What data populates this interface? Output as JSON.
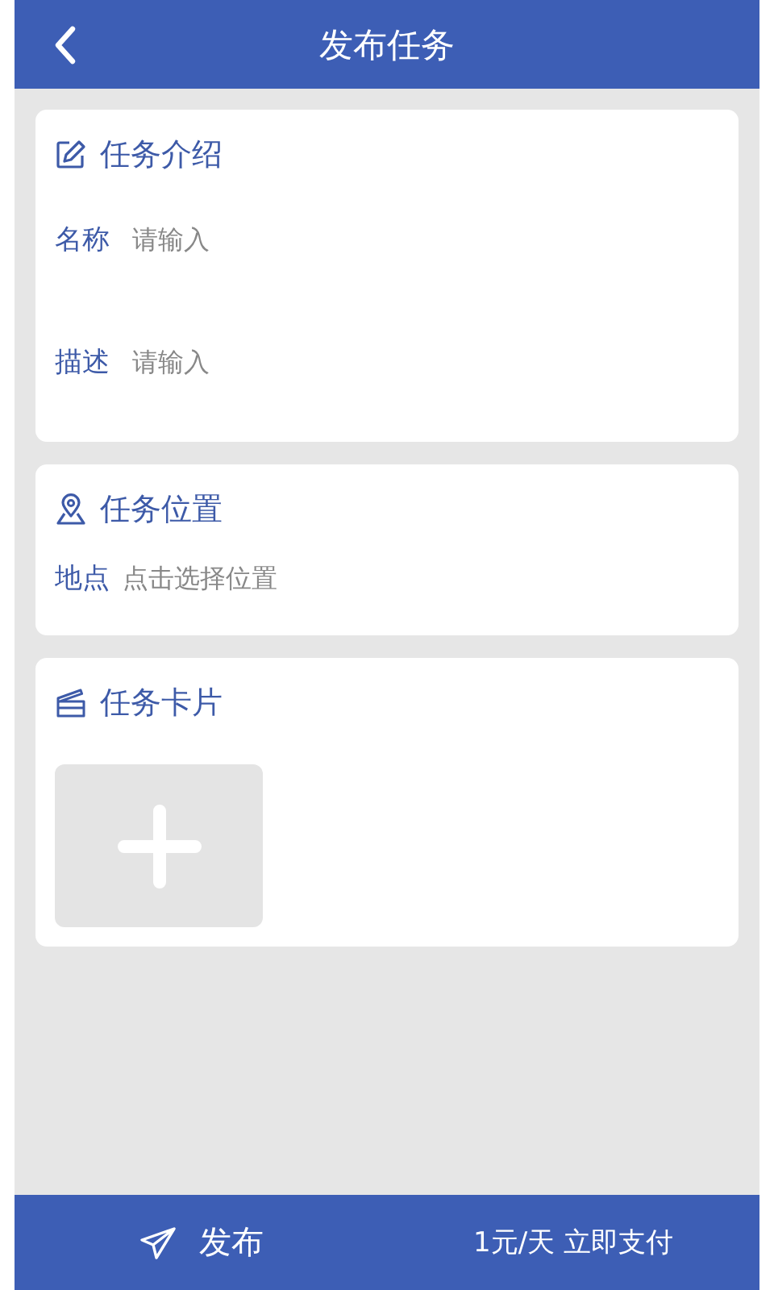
{
  "header": {
    "title": "发布任务"
  },
  "sections": [
    {
      "kind": "intro",
      "title": "任务介绍",
      "fields": [
        {
          "label": "名称",
          "placeholder": "请输入"
        },
        {
          "label": "描述",
          "placeholder": "请输入"
        }
      ]
    },
    {
      "kind": "location",
      "title": "任务位置",
      "fields": [
        {
          "label": "地点",
          "placeholder": "点击选择位置"
        }
      ]
    },
    {
      "kind": "cards",
      "title": "任务卡片"
    }
  ],
  "footer": {
    "publish": "发布",
    "pay": "1元/天 立即支付"
  }
}
